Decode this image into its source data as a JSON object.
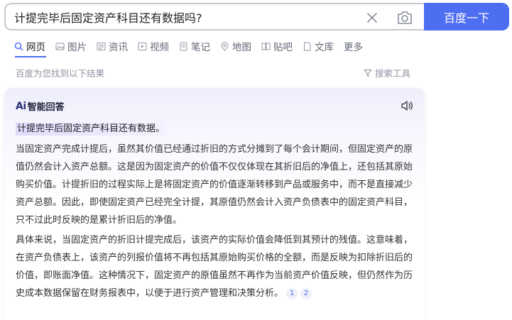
{
  "search": {
    "query": "计提完毕后固定资产科目还有数据吗?",
    "button_label": "百度一下"
  },
  "tabs": [
    {
      "label": "网页",
      "icon": "search-icon",
      "active": true
    },
    {
      "label": "图片",
      "icon": "image-icon"
    },
    {
      "label": "资讯",
      "icon": "news-icon"
    },
    {
      "label": "视频",
      "icon": "video-icon"
    },
    {
      "label": "笔记",
      "icon": "note-icon"
    },
    {
      "label": "地图",
      "icon": "map-icon"
    },
    {
      "label": "贴吧",
      "icon": "tieba-icon"
    },
    {
      "label": "文库",
      "icon": "doc-icon"
    },
    {
      "label": "更多",
      "icon": ""
    }
  ],
  "results": {
    "hint": "百度为您找到以下结果",
    "tools_label": "搜索工具"
  },
  "ai_answer": {
    "logo": "Ai",
    "title": "智能回答",
    "summary": "计提完毕后固定资产科目还有数据。",
    "paragraphs": [
      "当固定资产完成计提后，虽然其价值已经通过折旧的方式分摊到了每个会计期间，但固定资产的原值仍然会计入资产总额。这是因为固定资产的价值不仅仅体现在其折旧后的净值上，还包括其原始购买价值。计提折旧的过程实际上是将固定资产的价值逐渐转移到产品或服务中，而不是直接减少资产总额。因此，即使固定资产已经完全计提，其原值仍然会计入资产负债表中的固定资产科目，只不过此时反映的是累计折旧后的净值。",
      "具体来说，当固定资产的折旧计提完成后，该资产的实际价值会降低到其预计的残值。这意味着，在资产负债表上，该资产的列报价值将不再包括其原始购买价格的全额，而是反映为扣除折旧后的价值，即账面净值。这种情况下，固定资产的原值虽然不再作为当前资产价值反映，但仍然作为历史成本数据保留在财务报表中，以便于进行资产管理和决策分析。"
    ],
    "citations": [
      "1",
      "2"
    ]
  }
}
